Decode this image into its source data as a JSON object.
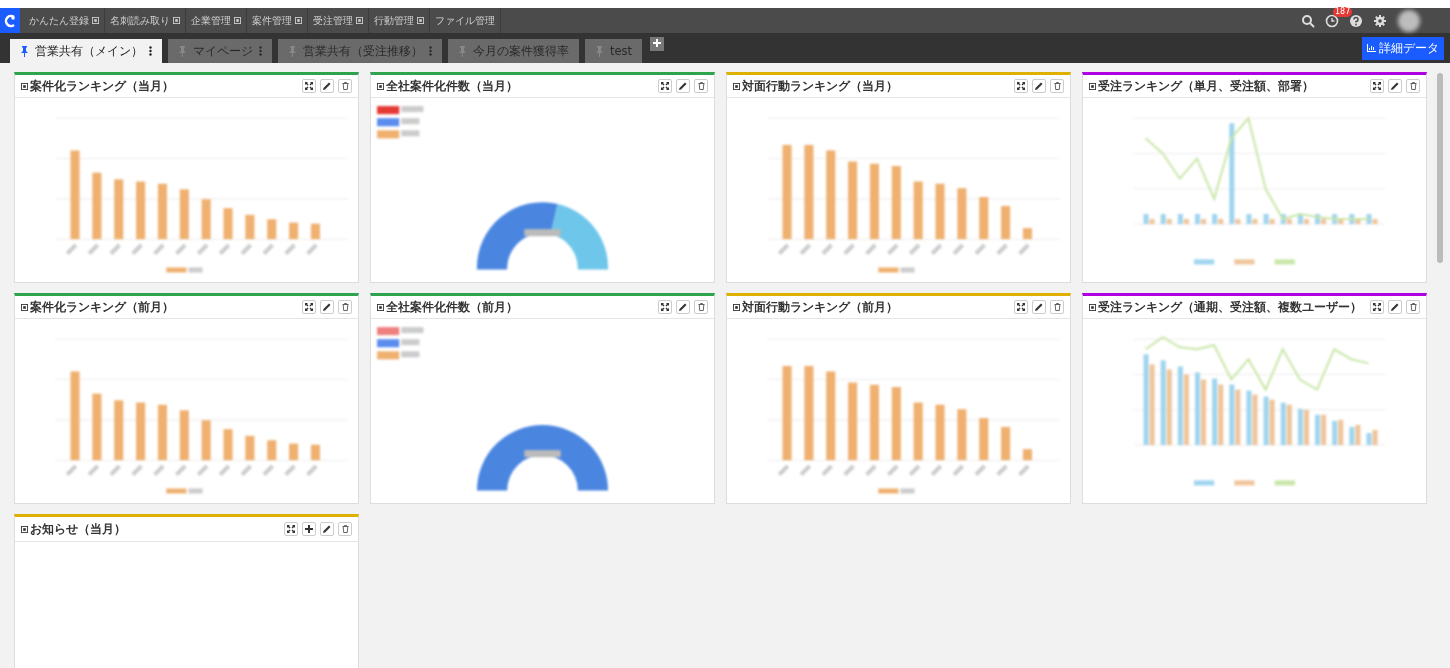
{
  "nav": {
    "items": [
      {
        "label": "かんたん登録",
        "has_menu": true
      },
      {
        "label": "名刺読み取り",
        "has_menu": true
      },
      {
        "label": "企業管理",
        "has_menu": true
      },
      {
        "label": "案件管理",
        "has_menu": true
      },
      {
        "label": "受注管理",
        "has_menu": true
      },
      {
        "label": "行動管理",
        "has_menu": true
      },
      {
        "label": "ファイル管理",
        "has_menu": false
      }
    ],
    "notification_badge": "187"
  },
  "tabs": [
    {
      "label": "営業共有（メイン）",
      "selected": true,
      "has_menu": true
    },
    {
      "label": "マイページ",
      "selected": false,
      "has_menu": true
    },
    {
      "label": "営業共有（受注推移）",
      "selected": false,
      "has_menu": true
    },
    {
      "label": "今月の案件獲得率",
      "selected": false,
      "has_menu": false
    },
    {
      "label": "test",
      "selected": false,
      "has_menu": false
    }
  ],
  "detail_button": "詳細データ",
  "widgets": [
    {
      "title": "案件化ランキング（当月）",
      "color": "#2ea44f",
      "kind": "bar",
      "can_add": false
    },
    {
      "title": "全社案件化件数（当月）",
      "color": "#2ea44f",
      "kind": "gauge",
      "can_add": false
    },
    {
      "title": "対面行動ランキング（当月）",
      "color": "#e0b000",
      "kind": "bar",
      "can_add": false
    },
    {
      "title": "受注ランキング（単月、受注額、部署）",
      "color": "#b000e0",
      "kind": "combo",
      "can_add": false
    },
    {
      "title": "案件化ランキング（前月）",
      "color": "#2ea44f",
      "kind": "bar",
      "can_add": false
    },
    {
      "title": "全社案件化件数（前月）",
      "color": "#2ea44f",
      "kind": "gauge",
      "can_add": false
    },
    {
      "title": "対面行動ランキング（前月）",
      "color": "#e0b000",
      "kind": "bar",
      "can_add": false
    },
    {
      "title": "受注ランキング（通期、受注額、複数ユーザー）",
      "color": "#b000e0",
      "kind": "combo",
      "can_add": false
    },
    {
      "title": "お知らせ（当月）",
      "color": "#e0b000",
      "kind": "notice",
      "can_add": true
    }
  ]
}
